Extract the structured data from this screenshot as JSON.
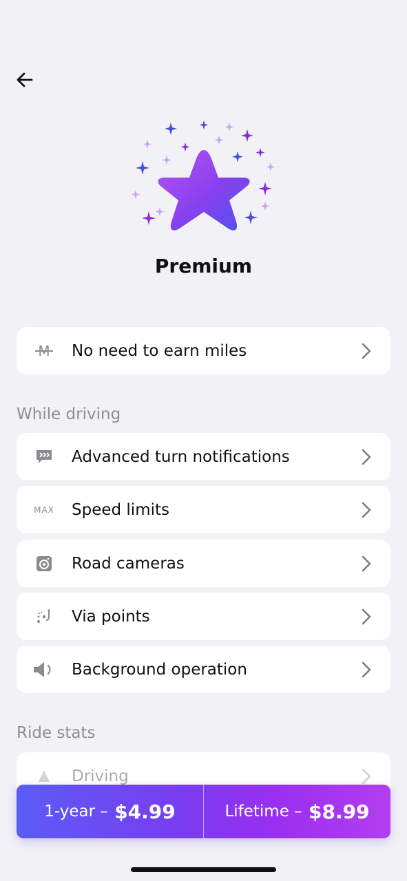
{
  "header": {
    "back_icon": "arrow-left-icon",
    "title": "Premium"
  },
  "hero": {
    "icon": "star-with-sparkles-icon",
    "colors": {
      "star_start": "#a64cf2",
      "star_end": "#5b4cf0",
      "sparkle_blue": "#4a4fd8",
      "sparkle_purple": "#8b2bd6",
      "sparkle_light": "#c8a6f0"
    }
  },
  "top_item": {
    "icon": "miles-strikethrough-icon",
    "icon_text": "M",
    "label": "No need to earn miles"
  },
  "sections": {
    "driving_title": "While driving",
    "driving_items": [
      {
        "icon": "turn-notification-icon",
        "label": "Advanced turn notifications"
      },
      {
        "icon": "max-speed-icon",
        "icon_text": "MAX",
        "label": "Speed limits"
      },
      {
        "icon": "camera-icon",
        "label": "Road cameras"
      },
      {
        "icon": "via-points-icon",
        "label": "Via points"
      },
      {
        "icon": "speaker-icon",
        "label": "Background operation"
      }
    ],
    "ride_stats_title": "Ride stats",
    "ride_stats_items": [
      {
        "icon": "stats-icon",
        "label": "Driving"
      }
    ]
  },
  "purchase": {
    "yearly_label": "1-year –",
    "yearly_price": "$4.99",
    "lifetime_label": "Lifetime –",
    "lifetime_price": "$8.99"
  },
  "colors": {
    "background": "#f1f1f6",
    "card": "#ffffff",
    "section_text": "#8e8e93",
    "chevron": "#7c7c82"
  }
}
